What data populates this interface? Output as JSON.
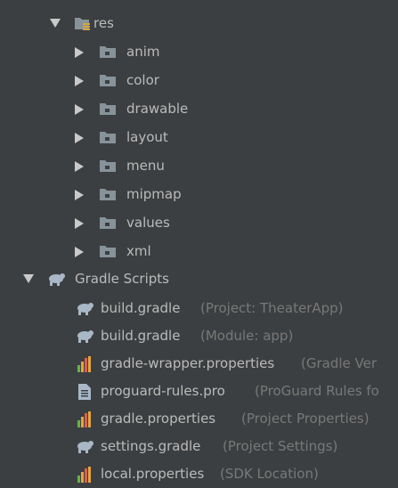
{
  "tree": {
    "res": {
      "label": "res"
    },
    "res_children": [
      {
        "label": "anim"
      },
      {
        "label": "color"
      },
      {
        "label": "drawable"
      },
      {
        "label": "layout"
      },
      {
        "label": "menu"
      },
      {
        "label": "mipmap"
      },
      {
        "label": "values"
      },
      {
        "label": "xml"
      }
    ],
    "gradle_scripts": {
      "label": "Gradle Scripts"
    },
    "gradle_files": [
      {
        "label": "build.gradle",
        "hint": "(Project: TheaterApp)",
        "icon": "gradle-icon"
      },
      {
        "label": "build.gradle",
        "hint": "(Module: app)",
        "icon": "gradle-icon"
      },
      {
        "label": "gradle-wrapper.properties",
        "hint": "(Gradle Ver",
        "icon": "properties-icon"
      },
      {
        "label": "proguard-rules.pro",
        "hint": "(ProGuard Rules fo",
        "icon": "text-file-icon"
      },
      {
        "label": "gradle.properties",
        "hint": "(Project Properties)",
        "icon": "properties-icon"
      },
      {
        "label": "settings.gradle",
        "hint": "(Project Settings)",
        "icon": "gradle-icon"
      },
      {
        "label": "local.properties",
        "hint": "(SDK Location)",
        "icon": "properties-icon"
      }
    ]
  },
  "colors": {
    "background": "#3c3f41",
    "text": "#bbbbbb",
    "hint": "#787878",
    "folder": "#87939a",
    "arrow": "#c9c9c9"
  }
}
